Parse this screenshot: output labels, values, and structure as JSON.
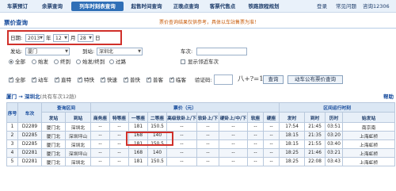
{
  "nav": {
    "tabs": [
      "车票预订",
      "余票查询",
      "列车时刻表查询",
      "起售时间查询",
      "正晚点查询",
      "客票代售点",
      "铁路旅程规划"
    ],
    "active_index": 2,
    "login": "登录",
    "faq": "常见问题",
    "hotline": "咨询12306"
  },
  "panel": {
    "title": "票价查询",
    "notice": "票价查询结果仅供参考，具体以车站售票为准！"
  },
  "form": {
    "date_label": "日期:",
    "year": "2013",
    "year_unit": "年",
    "month": "12",
    "month_unit": "月",
    "day": "28",
    "day_unit": "日",
    "from_label": "发站:",
    "from_value": "厦门",
    "to_label": "到站:",
    "to_value": "深圳北",
    "train_label": "车次:",
    "train_value": "",
    "direction_options": [
      "全部",
      "始发",
      "终到",
      "始发/终到",
      "过路"
    ],
    "direction_selected": 0,
    "show_nearby": "显示邻近车次",
    "type_options": [
      "全部",
      "动车",
      "直特",
      "特快",
      "快速",
      "普快",
      "普客",
      "临客"
    ],
    "captcha_label": "验证码:",
    "captcha_value": "",
    "captcha_image_text": "八+?=13",
    "query_button": "查询",
    "bus_button": "动车公布票价查询"
  },
  "results": {
    "route_title": "厦门 → 深圳北",
    "route_subtitle": "(共有车次12趟)",
    "help": "帮助",
    "header_top": [
      "序号",
      "车次",
      "查询区间",
      "票价（元）",
      "区间运行时刻"
    ],
    "header_sub": [
      "发站",
      "到站",
      "商务座",
      "特等座",
      "一等座",
      "二等座",
      "高级软卧上/下",
      "软卧上/下",
      "硬卧上/中/下",
      "软座",
      "硬座",
      "发时",
      "到时",
      "历时",
      "始发站"
    ],
    "rows": [
      [
        "1",
        "D2289",
        "厦门北",
        "深圳北",
        "--",
        "--",
        "181",
        "150.5",
        "--",
        "--",
        "--",
        "--",
        "--",
        "17:54",
        "21:45",
        "03:51",
        "南京南"
      ],
      [
        "2",
        "D2285",
        "厦门北",
        "深圳坪山",
        "--",
        "--",
        "168",
        "140",
        "--",
        "--",
        "--",
        "--",
        "--",
        "18:15",
        "21:35",
        "03:20",
        "上海虹桥"
      ],
      [
        "3",
        "D2285",
        "厦门北",
        "深圳北",
        "--",
        "--",
        "181",
        "150.5",
        "--",
        "--",
        "--",
        "--",
        "--",
        "18:15",
        "21:55",
        "03:40",
        "上海虹桥"
      ],
      [
        "4",
        "D2281",
        "厦门北",
        "深圳坪山",
        "--",
        "--",
        "168",
        "140",
        "--",
        "--",
        "--",
        "--",
        "--",
        "18:25",
        "21:46",
        "03:21",
        "上海虹桥"
      ],
      [
        "5",
        "D2281",
        "厦门北",
        "深圳北",
        "--",
        "--",
        "181",
        "150.5",
        "--",
        "--",
        "--",
        "--",
        "--",
        "18:25",
        "22:08",
        "03:43",
        "上海虹桥"
      ]
    ]
  }
}
